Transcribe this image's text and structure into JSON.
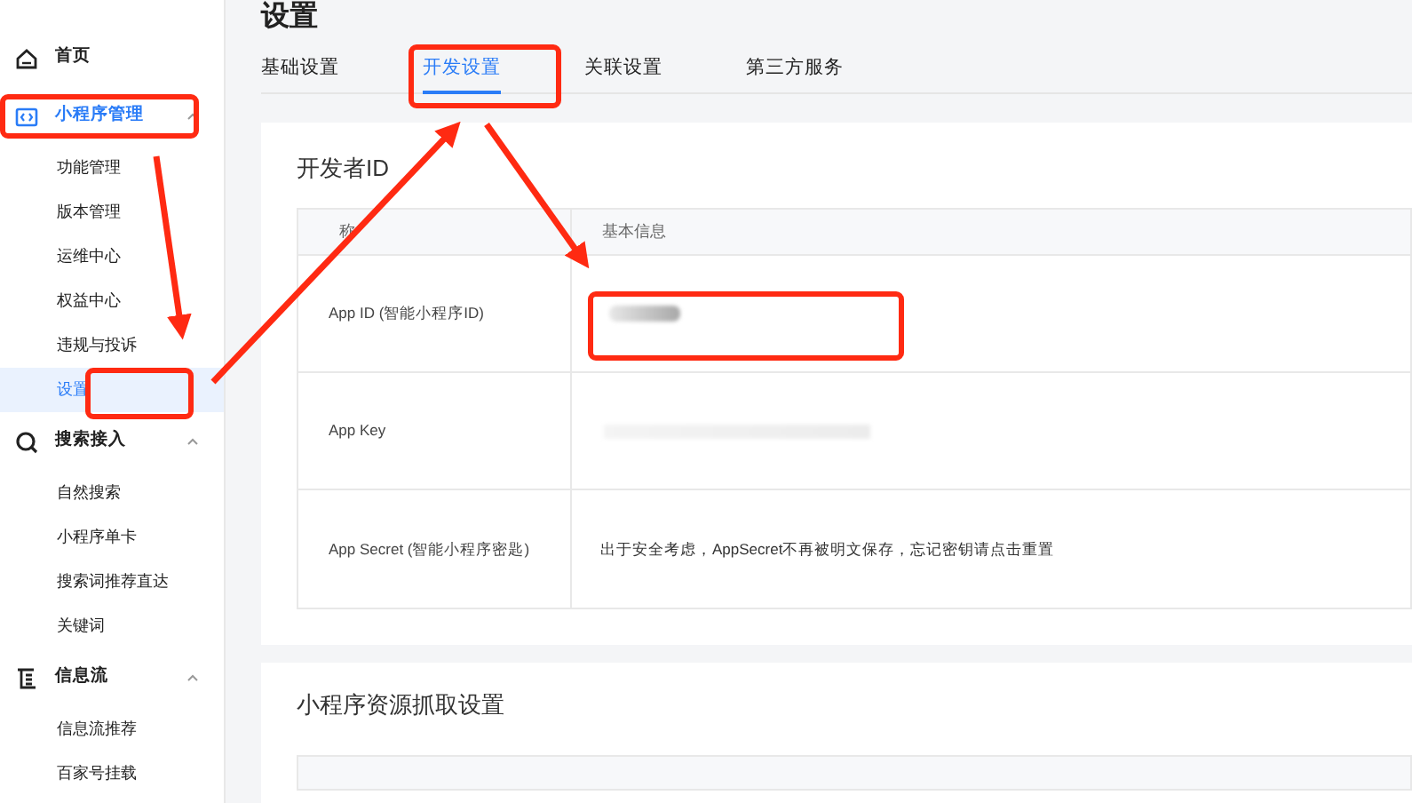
{
  "sidebar": {
    "items": [
      {
        "label": "首页",
        "selected": false
      },
      {
        "label": "小程序管理",
        "expanded": true,
        "selected": true,
        "children": [
          {
            "label": "功能管理",
            "selected": false
          },
          {
            "label": "版本管理",
            "selected": false
          },
          {
            "label": "运维中心",
            "selected": false
          },
          {
            "label": "权益中心",
            "selected": false
          },
          {
            "label": "违规与投诉",
            "selected": false
          },
          {
            "label": "设置",
            "selected": true
          }
        ]
      },
      {
        "label": "搜索接入",
        "expanded": true,
        "selected": false,
        "children": [
          {
            "label": "自然搜索",
            "selected": false
          },
          {
            "label": "小程序单卡",
            "selected": false
          },
          {
            "label": "搜索词推荐直达",
            "selected": false
          },
          {
            "label": "关键词",
            "selected": false
          }
        ]
      },
      {
        "label": "信息流",
        "expanded": true,
        "selected": false,
        "children": [
          {
            "label": "信息流推荐",
            "selected": false
          },
          {
            "label": "百家号挂载",
            "selected": false
          }
        ]
      }
    ]
  },
  "page_title": "设置",
  "tabs": [
    {
      "label": "基础设置",
      "selected": false
    },
    {
      "label": "开发设置",
      "selected": true
    },
    {
      "label": "关联设置",
      "selected": false
    },
    {
      "label": "第三方服务",
      "selected": false
    }
  ],
  "developer_card": {
    "title": "开发者ID",
    "columns": [
      "称",
      "基本信息"
    ],
    "rows": [
      {
        "name": "App ID (智能小程序ID)",
        "kind": "redacted"
      },
      {
        "name": "App Key",
        "kind": "redacted"
      },
      {
        "name": "App Secret (智能小程序密匙)",
        "kind": "text",
        "value": "出于安全考虑，AppSecret不再被明文保存，忘记密钥请点击重置"
      }
    ]
  },
  "resource_card": {
    "title": "小程序资源抓取设置"
  }
}
